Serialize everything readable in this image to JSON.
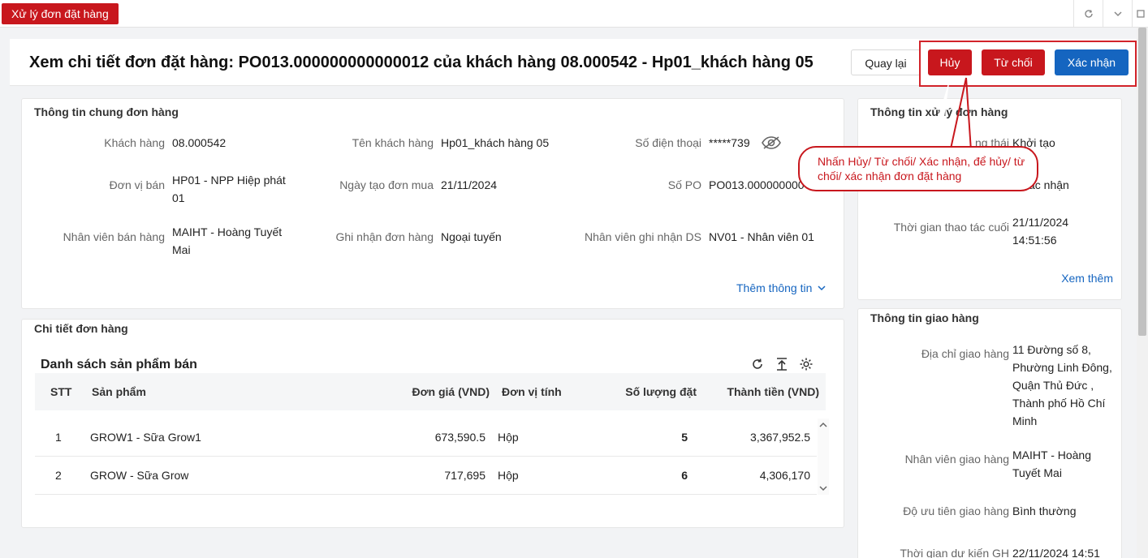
{
  "tabbar": {
    "active_tab": "Xử lý đơn đặt hàng"
  },
  "header": {
    "title": "Xem chi tiết đơn đặt hàng: PO013.000000000000012 của khách hàng 08.000542 - Hp01_khách hàng 05",
    "back_label": "Quay lại",
    "cancel_label": "Hủy",
    "reject_label": "Từ chối",
    "confirm_label": "Xác nhận"
  },
  "general_info": {
    "title": "Thông tin chung đơn hàng",
    "fields": {
      "customer_label": "Khách hàng",
      "customer_value": "08.000542",
      "customer_name_label": "Tên khách hàng",
      "customer_name_value": "Hp01_khách hàng 05",
      "phone_label": "Số điện thoại",
      "phone_value": "*****739",
      "seller_unit_label": "Đơn vị bán",
      "seller_unit_value": "HP01 - NPP Hiệp phát 01",
      "order_date_label": "Ngày tạo đơn mua",
      "order_date_value": "21/11/2024",
      "po_label": "Số PO",
      "po_value": "PO013.000000000",
      "sales_staff_label": "Nhân viên bán hàng",
      "sales_staff_value": "MAIHT - Hoàng Tuyết Mai",
      "recorded_label": "Ghi nhận đơn hàng",
      "recorded_value": "Ngoại tuyến",
      "sales_recorder_label": "Nhân viên ghi nhận DS",
      "sales_recorder_value": "NV01 - Nhân viên 01"
    },
    "more_label": "Thêm thông tin"
  },
  "order_detail": {
    "title": "Chi tiết đơn hàng",
    "list_title": "Danh sách sản phẩm bán",
    "columns": [
      "STT",
      "Sản phẩm",
      "Đơn giá (VND)",
      "Đơn vị tính",
      "Số lượng đặt",
      "Thành tiền (VND)"
    ],
    "rows": [
      [
        "1",
        "GROW1 - Sữa Grow1",
        "673,590.5",
        "Hộp",
        "5",
        "3,367,952.5"
      ],
      [
        "2",
        "GROW - Sữa Grow",
        "717,695",
        "Hộp",
        "6",
        "4,306,170"
      ]
    ]
  },
  "processing_info": {
    "title": "Thông tin xử lý đơn hàng",
    "status_label": "ng thái",
    "status_value": "Khởi tạo",
    "confirm_value": "xác nhận",
    "last_action_label": "Thời gian thao tác cuối",
    "last_action_value": "21/11/2024 14:51:56",
    "more_label": "Xem thêm"
  },
  "delivery_info": {
    "title": "Thông tin giao hàng",
    "address_label": "Địa chỉ giao hàng",
    "address_value": "11 Đường số 8, Phường Linh Đông, Quận Thủ Đức , Thành phố Hồ Chí Minh",
    "staff_label": "Nhân viên giao hàng",
    "staff_value": "MAIHT - Hoàng Tuyết Mai",
    "priority_label": "Độ ưu tiên giao hàng",
    "priority_value": "Bình thường",
    "eta_label": "Thời gian dự kiến GH",
    "eta_value": "22/11/2024 14:51"
  },
  "annotation": {
    "callout_text": "Nhấn Hủy/ Từ chối/ Xác nhận, để hủy/ từ chối/ xác nhận đơn đặt hàng"
  },
  "colors": {
    "brand_red": "#c8171d",
    "primary_blue": "#1565c0"
  }
}
